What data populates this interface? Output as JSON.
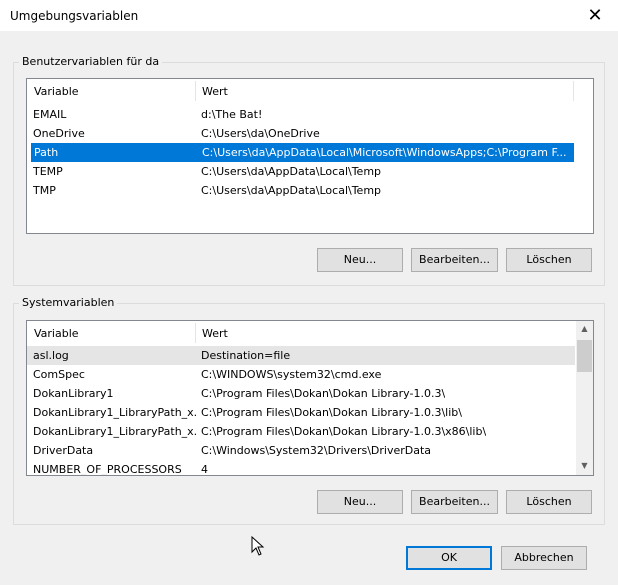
{
  "window": {
    "title": "Umgebungsvariablen",
    "close_glyph": "✕"
  },
  "user": {
    "legend": "Benutzervariablen für da",
    "columns": {
      "variable": "Variable",
      "value": "Wert"
    },
    "rows": [
      {
        "name": "EMAIL",
        "value": "d:\\The Bat!"
      },
      {
        "name": "OneDrive",
        "value": "C:\\Users\\da\\OneDrive"
      },
      {
        "name": "Path",
        "value": "C:\\Users\\da\\AppData\\Local\\Microsoft\\WindowsApps;C:\\Program F..."
      },
      {
        "name": "TEMP",
        "value": "C:\\Users\\da\\AppData\\Local\\Temp"
      },
      {
        "name": "TMP",
        "value": "C:\\Users\\da\\AppData\\Local\\Temp"
      }
    ],
    "buttons": {
      "new": "Neu...",
      "edit": "Bearbeiten...",
      "delete": "Löschen"
    }
  },
  "system": {
    "legend": "Systemvariablen",
    "columns": {
      "variable": "Variable",
      "value": "Wert"
    },
    "rows": [
      {
        "name": "asl.log",
        "value": "Destination=file"
      },
      {
        "name": "ComSpec",
        "value": "C:\\WINDOWS\\system32\\cmd.exe"
      },
      {
        "name": "DokanLibrary1",
        "value": "C:\\Program Files\\Dokan\\Dokan Library-1.0.3\\"
      },
      {
        "name": "DokanLibrary1_LibraryPath_x...",
        "value": "C:\\Program Files\\Dokan\\Dokan Library-1.0.3\\lib\\"
      },
      {
        "name": "DokanLibrary1_LibraryPath_x...",
        "value": "C:\\Program Files\\Dokan\\Dokan Library-1.0.3\\x86\\lib\\"
      },
      {
        "name": "DriverData",
        "value": "C:\\Windows\\System32\\Drivers\\DriverData"
      },
      {
        "name": "NUMBER_OF_PROCESSORS",
        "value": "4"
      }
    ],
    "buttons": {
      "new": "Neu...",
      "edit": "Bearbeiten...",
      "delete": "Löschen"
    }
  },
  "footer": {
    "ok": "OK",
    "cancel": "Abbrechen"
  },
  "colors": {
    "selection": "#0078d7",
    "default_border": "#0078d7"
  }
}
